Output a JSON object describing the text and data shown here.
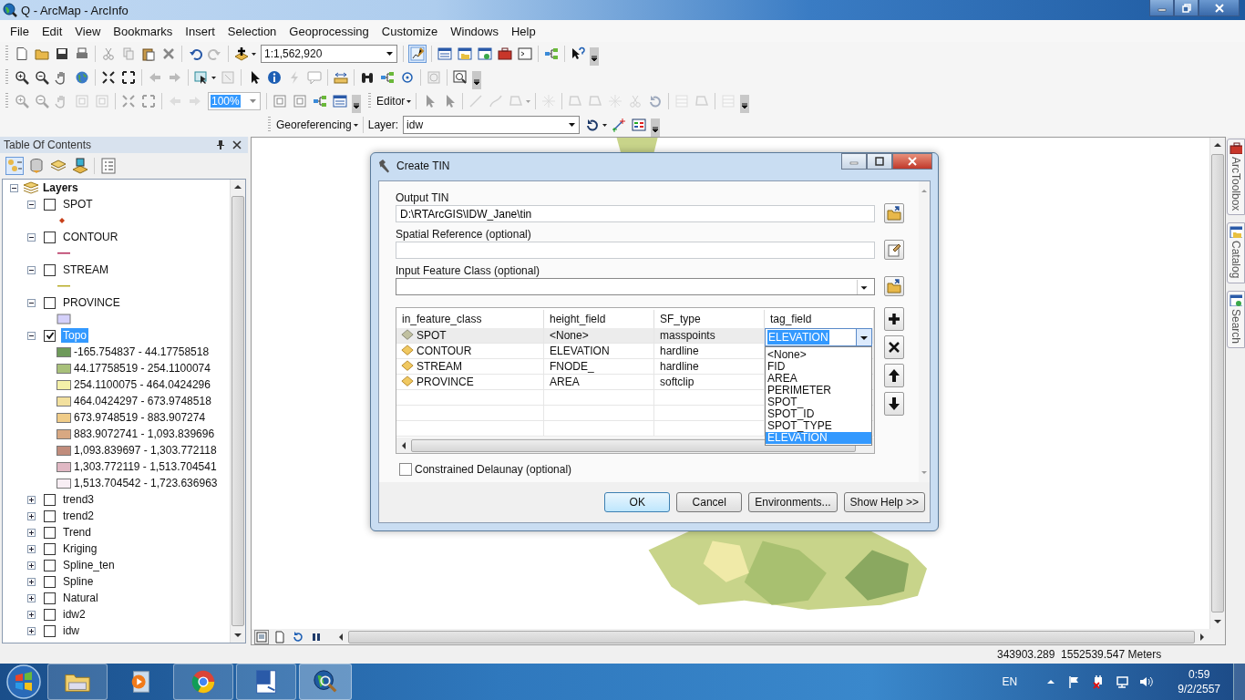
{
  "window": {
    "title": "Q - ArcMap - ArcInfo"
  },
  "menu": [
    "File",
    "Edit",
    "View",
    "Bookmarks",
    "Insert",
    "Selection",
    "Geoprocessing",
    "Customize",
    "Windows",
    "Help"
  ],
  "toolbars": {
    "scale": "1:1,562,920",
    "zoom": "100%",
    "editor": "Editor",
    "georeferencing": "Georeferencing",
    "layer_label": "Layer:",
    "layer": "idw"
  },
  "toc": {
    "title": "Table Of Contents",
    "root": {
      "label": "Layers",
      "expanded": true,
      "children": [
        {
          "label": "SPOT",
          "checked": false,
          "expanded": true,
          "selected": false,
          "symbol": {
            "kind": "point",
            "color": "#c8401a"
          }
        },
        {
          "label": "CONTOUR",
          "checked": false,
          "expanded": true,
          "selected": false,
          "symbol": {
            "kind": "line",
            "color": "#b42a5a"
          }
        },
        {
          "label": "STREAM",
          "checked": false,
          "expanded": true,
          "selected": false,
          "symbol": {
            "kind": "line",
            "color": "#b8ac26"
          }
        },
        {
          "label": "PROVINCE",
          "checked": false,
          "expanded": true,
          "selected": false,
          "symbol": {
            "kind": "polygon",
            "color": "#d4d0fa"
          }
        },
        {
          "label": "Topo",
          "checked": true,
          "expanded": true,
          "selected": true,
          "legend": [
            {
              "label": "-165.754837 - 44.17758518",
              "color": "#6e9a5a"
            },
            {
              "label": "44.17758519 - 254.1100074",
              "color": "#a8c07a"
            },
            {
              "label": "254.1100075 - 464.0424296",
              "color": "#f4f0a8"
            },
            {
              "label": "464.0424297 - 673.9748518",
              "color": "#f2e09e"
            },
            {
              "label": "673.9748519 - 883.907274",
              "color": "#f0cc88"
            },
            {
              "label": "883.9072741 - 1,093.839696",
              "color": "#d8a882"
            },
            {
              "label": "1,093.839697 - 1,303.772118",
              "color": "#c08c7c"
            },
            {
              "label": "1,303.772119 - 1,513.704541",
              "color": "#e0b8c4"
            },
            {
              "label": "1,513.704542 - 1,723.636963",
              "color": "#f8eef4"
            }
          ]
        },
        {
          "label": "trend3",
          "checked": false,
          "expanded": false,
          "selected": false
        },
        {
          "label": "trend2",
          "checked": false,
          "expanded": false,
          "selected": false
        },
        {
          "label": "Trend",
          "checked": false,
          "expanded": false,
          "selected": false
        },
        {
          "label": "Kriging",
          "checked": false,
          "expanded": false,
          "selected": false
        },
        {
          "label": "Spline_ten",
          "checked": false,
          "expanded": false,
          "selected": false
        },
        {
          "label": "Spline",
          "checked": false,
          "expanded": false,
          "selected": false
        },
        {
          "label": "Natural",
          "checked": false,
          "expanded": false,
          "selected": false
        },
        {
          "label": "idw2",
          "checked": false,
          "expanded": false,
          "selected": false
        },
        {
          "label": "idw",
          "checked": false,
          "expanded": false,
          "selected": false
        }
      ]
    }
  },
  "dock_tabs": [
    "ArcToolbox",
    "Catalog",
    "Search"
  ],
  "dialog": {
    "title": "Create TIN",
    "output_tin": {
      "label": "Output TIN",
      "value": "D:\\RTArcGIS\\IDW_Jane\\tin"
    },
    "spatial_reference": {
      "label": "Spatial Reference (optional)"
    },
    "input_feature_class": {
      "label": "Input Feature Class (optional)"
    },
    "table": {
      "columns": [
        "in_feature_class",
        "height_field",
        "SF_type",
        "tag_field"
      ],
      "rows": [
        {
          "in_feature_class": "SPOT",
          "height_field": "<None>",
          "sf_type": "masspoints",
          "tag_field": "ELEVATION",
          "selected": true
        },
        {
          "in_feature_class": "CONTOUR",
          "height_field": "ELEVATION",
          "sf_type": "hardline",
          "selected": false
        },
        {
          "in_feature_class": "STREAM",
          "height_field": "FNODE_",
          "sf_type": "hardline",
          "selected": false
        },
        {
          "in_feature_class": "PROVINCE",
          "height_field": "AREA",
          "sf_type": "softclip",
          "selected": false
        }
      ]
    },
    "dropdown": [
      {
        "label": "<None>",
        "selected": false
      },
      {
        "label": "FID",
        "selected": false
      },
      {
        "label": "AREA",
        "selected": false
      },
      {
        "label": "PERIMETER",
        "selected": false
      },
      {
        "label": "SPOT_",
        "selected": false
      },
      {
        "label": "SPOT_ID",
        "selected": false
      },
      {
        "label": "SPOT_TYPE",
        "selected": false
      },
      {
        "label": "ELEVATION",
        "selected": true
      }
    ],
    "constrained_delaunay": {
      "label": "Constrained Delaunay (optional)",
      "checked": false
    },
    "buttons": [
      {
        "label": "OK",
        "focused": true
      },
      {
        "label": "Cancel",
        "focused": false
      },
      {
        "label": "Environments...",
        "focused": false
      },
      {
        "label": "Show Help >>",
        "focused": false
      }
    ]
  },
  "status_bar": {
    "coordinates": "343903.289  1552539.547 Meters"
  },
  "taskbar": {
    "language": "EN",
    "time": "0:59",
    "date": "9/2/2557"
  }
}
